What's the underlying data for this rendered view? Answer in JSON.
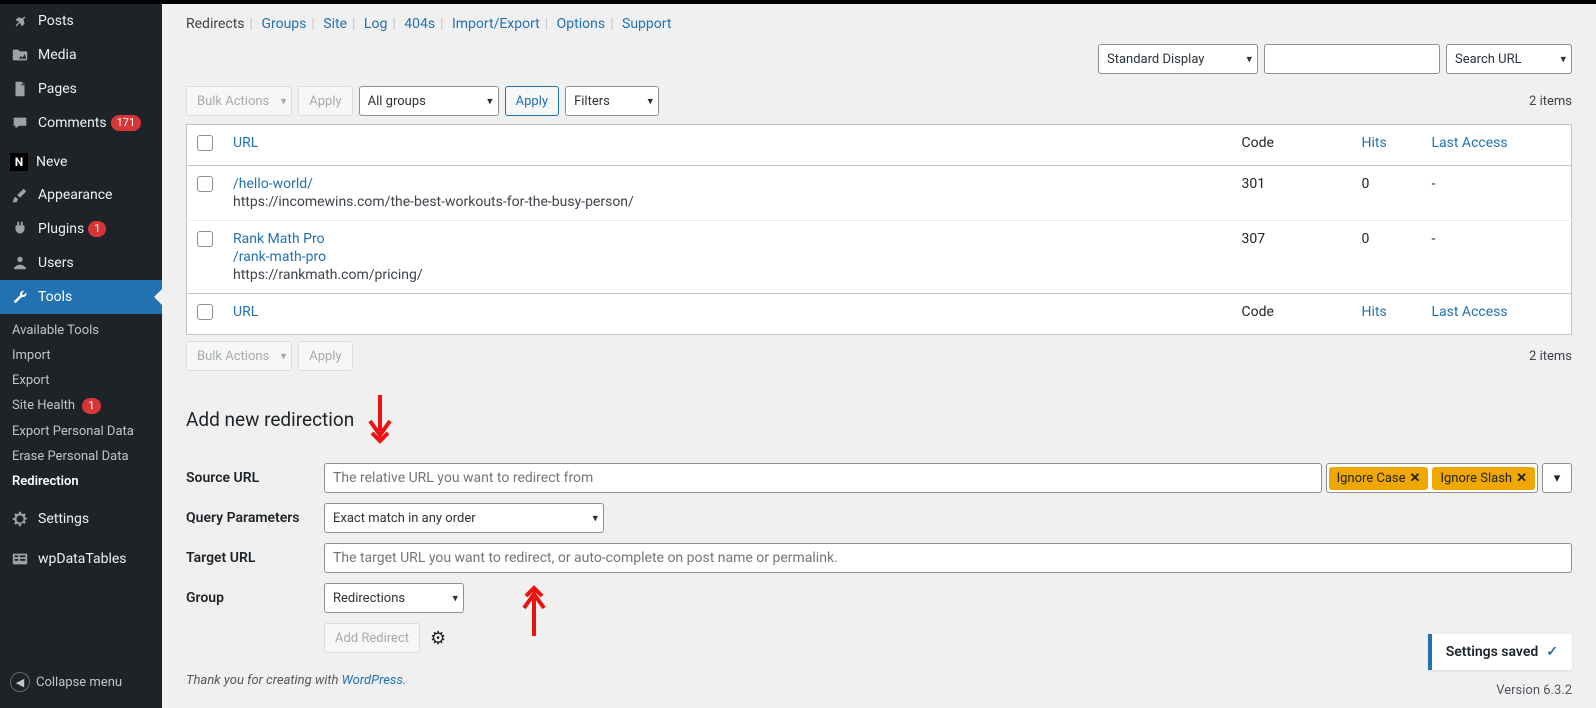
{
  "sidebar": {
    "items": [
      {
        "icon": "pin",
        "label": "Posts"
      },
      {
        "icon": "media",
        "label": "Media"
      },
      {
        "icon": "page",
        "label": "Pages"
      },
      {
        "icon": "comment",
        "label": "Comments",
        "badge": "171"
      },
      {
        "icon": "neve",
        "label": "Neve"
      },
      {
        "icon": "brush",
        "label": "Appearance"
      },
      {
        "icon": "plug",
        "label": "Plugins",
        "badge": "1"
      },
      {
        "icon": "user",
        "label": "Users"
      },
      {
        "icon": "wrench",
        "label": "Tools"
      },
      {
        "icon": "gear",
        "label": "Settings"
      },
      {
        "icon": "wpdt",
        "label": "wpDataTables"
      }
    ],
    "submenu": [
      "Available Tools",
      "Import",
      "Export",
      "Site Health",
      "Export Personal Data",
      "Erase Personal Data",
      "Redirection"
    ],
    "site_health_badge": "1",
    "collapse": "Collapse menu"
  },
  "tabs": [
    "Redirects",
    "Groups",
    "Site",
    "Log",
    "404s",
    "Import/Export",
    "Options",
    "Support"
  ],
  "filters": {
    "bulk": "Bulk Actions",
    "apply": "Apply",
    "groups": "All groups",
    "filters": "Filters",
    "display": "Standard Display",
    "search_label": "Search URL",
    "items_count": "2 items"
  },
  "table": {
    "headers": {
      "url": "URL",
      "code": "Code",
      "hits": "Hits",
      "last": "Last Access"
    },
    "rows": [
      {
        "title": "/hello-world/",
        "dest": "https://incomewins.com/the-best-workouts-for-the-busy-person/",
        "code": "301",
        "hits": "0",
        "last": "-"
      },
      {
        "title": "Rank Math Pro",
        "title2": "/rank-math-pro",
        "dest": "https://rankmath.com/pricing/",
        "code": "307",
        "hits": "0",
        "last": "-"
      }
    ]
  },
  "form": {
    "heading": "Add new redirection",
    "source_label": "Source URL",
    "source_ph": "The relative URL you want to redirect from",
    "tag_case": "Ignore Case",
    "tag_slash": "Ignore Slash",
    "query_label": "Query Parameters",
    "query_value": "Exact match in any order",
    "target_label": "Target URL",
    "target_ph": "The target URL you want to redirect, or auto-complete on post name or permalink.",
    "group_label": "Group",
    "group_value": "Redirections",
    "add_btn": "Add Redirect"
  },
  "footer": {
    "thanks_pre": "Thank you for creating with ",
    "thanks_link": "WordPress",
    "thanks_post": ".",
    "version": "Version 6.3.2",
    "toast": "Settings saved"
  }
}
